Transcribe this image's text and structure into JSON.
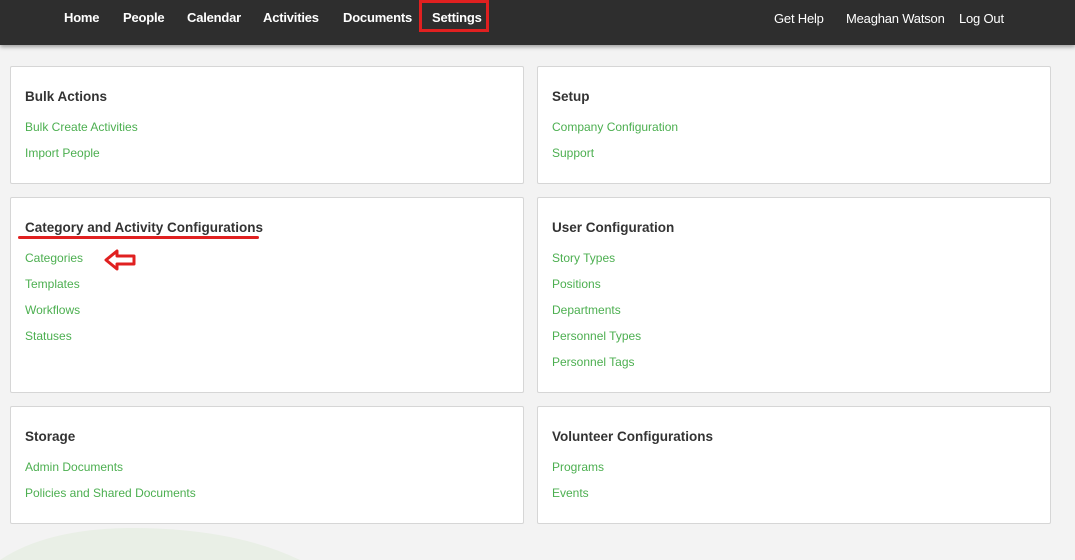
{
  "nav": {
    "left": [
      "Home",
      "People",
      "Calendar",
      "Activities",
      "Documents",
      "Settings"
    ],
    "right": [
      "Get Help",
      "Meaghan Watson",
      "Log Out"
    ]
  },
  "cards": {
    "bulk_actions": {
      "title": "Bulk Actions",
      "links": [
        "Bulk Create Activities",
        "Import People"
      ]
    },
    "setup": {
      "title": "Setup",
      "links": [
        "Company Configuration",
        "Support"
      ]
    },
    "category_activity": {
      "title": "Category and Activity Configurations",
      "links": [
        "Categories",
        "Templates",
        "Workflows",
        "Statuses"
      ]
    },
    "user_config": {
      "title": "User Configuration",
      "links": [
        "Story Types",
        "Positions",
        "Departments",
        "Personnel Types",
        "Personnel Tags"
      ]
    },
    "storage": {
      "title": "Storage",
      "links": [
        "Admin Documents",
        "Policies and Shared Documents"
      ]
    },
    "volunteer": {
      "title": "Volunteer Configurations",
      "links": [
        "Programs",
        "Events"
      ]
    }
  },
  "colors": {
    "topbar": "#2e2e2e",
    "link": "#4caf50",
    "annotation": "#e02020"
  }
}
